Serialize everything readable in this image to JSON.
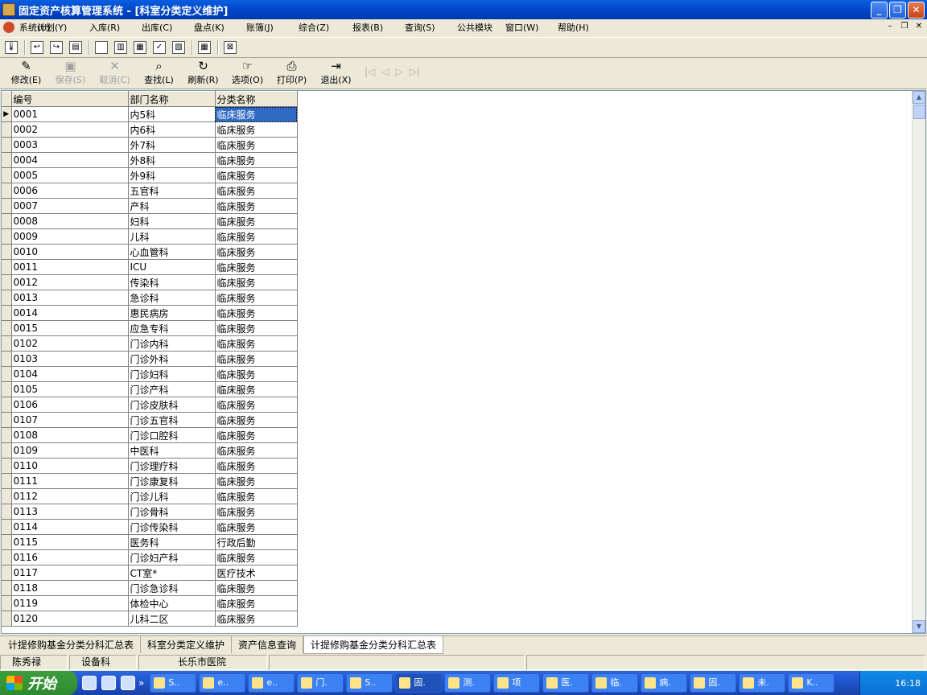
{
  "window": {
    "title": "固定资产核算管理系统 - [科室分类定义维护]"
  },
  "menu": [
    "系统(U)",
    "计划(Y)",
    "入库(R)",
    "出库(C)",
    "盘点(K)",
    "账簿(J)",
    "综合(Z)",
    "报表(B)",
    "查询(S)",
    "公共模块",
    "窗口(W)",
    "帮助(H)"
  ],
  "toolbar": [
    {
      "label": "修改(E)",
      "icon": "edit-icon",
      "enabled": true
    },
    {
      "label": "保存(S)",
      "icon": "save-icon",
      "enabled": false
    },
    {
      "label": "取消(C)",
      "icon": "cancel-icon",
      "enabled": false
    },
    {
      "label": "查找(L)",
      "icon": "search-icon",
      "enabled": true
    },
    {
      "label": "刷新(R)",
      "icon": "refresh-icon",
      "enabled": true
    },
    {
      "label": "选项(O)",
      "icon": "options-icon",
      "enabled": true
    },
    {
      "label": "打印(P)",
      "icon": "print-icon",
      "enabled": true
    },
    {
      "label": "退出(X)",
      "icon": "exit-icon",
      "enabled": true
    }
  ],
  "grid": {
    "columns": [
      "编号",
      "部门名称",
      "分类名称"
    ],
    "rows": [
      [
        "0001",
        "内5科",
        "临床服务"
      ],
      [
        "0002",
        "内6科",
        "临床服务"
      ],
      [
        "0003",
        "外7科",
        "临床服务"
      ],
      [
        "0004",
        "外8科",
        "临床服务"
      ],
      [
        "0005",
        "外9科",
        "临床服务"
      ],
      [
        "0006",
        "五官科",
        "临床服务"
      ],
      [
        "0007",
        "产科",
        "临床服务"
      ],
      [
        "0008",
        "妇科",
        "临床服务"
      ],
      [
        "0009",
        "儿科",
        "临床服务"
      ],
      [
        "0010",
        "心血管科",
        "临床服务"
      ],
      [
        "0011",
        "ICU",
        "临床服务"
      ],
      [
        "0012",
        "传染科",
        "临床服务"
      ],
      [
        "0013",
        "急诊科",
        "临床服务"
      ],
      [
        "0014",
        "惠民病房",
        "临床服务"
      ],
      [
        "0015",
        "应急专科",
        "临床服务"
      ],
      [
        "0102",
        "门诊内科",
        "临床服务"
      ],
      [
        "0103",
        "门诊外科",
        "临床服务"
      ],
      [
        "0104",
        "门诊妇科",
        "临床服务"
      ],
      [
        "0105",
        "门诊产科",
        "临床服务"
      ],
      [
        "0106",
        "门诊皮肤科",
        "临床服务"
      ],
      [
        "0107",
        "门诊五官科",
        "临床服务"
      ],
      [
        "0108",
        "门诊口腔科",
        "临床服务"
      ],
      [
        "0109",
        "中医科",
        "临床服务"
      ],
      [
        "0110",
        "门诊理疗科",
        "临床服务"
      ],
      [
        "0111",
        "门诊康复科",
        "临床服务"
      ],
      [
        "0112",
        "门诊儿科",
        "临床服务"
      ],
      [
        "0113",
        "门诊骨科",
        "临床服务"
      ],
      [
        "0114",
        "门诊传染科",
        "临床服务"
      ],
      [
        "0115",
        "医务科",
        "行政后勤"
      ],
      [
        "0116",
        "门诊妇产科",
        "临床服务"
      ],
      [
        "0117",
        "CT室*",
        "医疗技术"
      ],
      [
        "0118",
        "门诊急诊科",
        "临床服务"
      ],
      [
        "0119",
        "体检中心",
        "临床服务"
      ],
      [
        "0120",
        "儿科二区",
        "临床服务"
      ]
    ]
  },
  "tabs": [
    "计提修购基金分类分科汇总表",
    "科室分类定义维护",
    "资产信息查询",
    "计提修购基金分类分科汇总表"
  ],
  "status": [
    "陈秀禄",
    "设备科",
    "长乐市医院"
  ],
  "taskbar": {
    "start": "开始",
    "tasks": [
      "S..",
      "e..",
      "e..",
      "门.",
      "S..",
      "固.",
      "测.",
      "项",
      "医.",
      "临.",
      "病.",
      "固.",
      "未.",
      "K.."
    ],
    "clock": "16:18"
  }
}
